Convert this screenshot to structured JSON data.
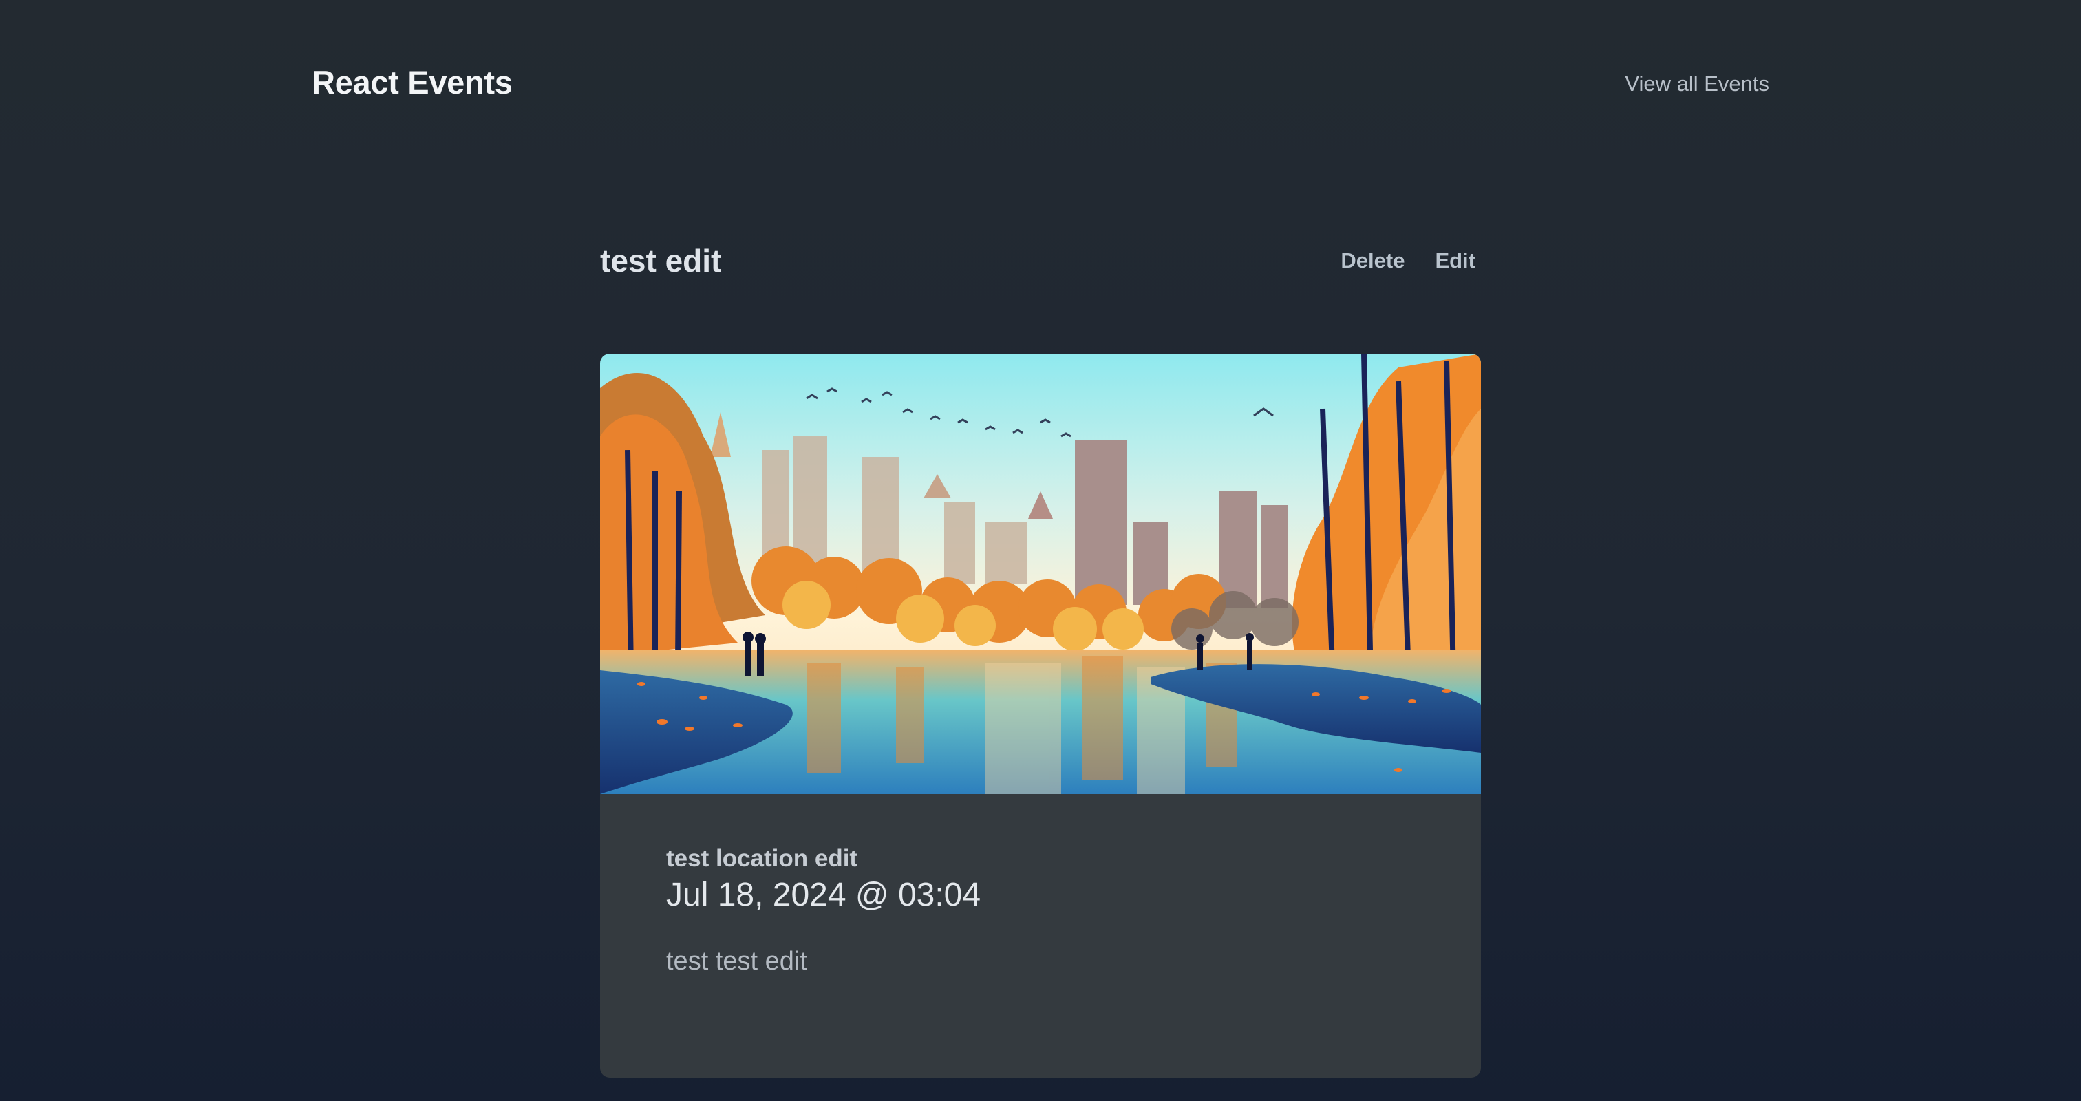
{
  "header": {
    "brand": "React Events",
    "nav_link": "View all Events"
  },
  "event": {
    "title": "test edit",
    "actions": {
      "delete_label": "Delete",
      "edit_label": "Edit"
    },
    "image_alt": "Autumn park with lake and city skyline illustration",
    "location": "test location edit",
    "datetime": "Jul 18, 2024 @ 03:04",
    "description": "test test edit"
  },
  "colors": {
    "background_top": "#232a31",
    "background_bottom": "#161f31",
    "card": "#343a3f",
    "accent_orange": "#f08a2c",
    "sky": "#8fe9ee"
  }
}
